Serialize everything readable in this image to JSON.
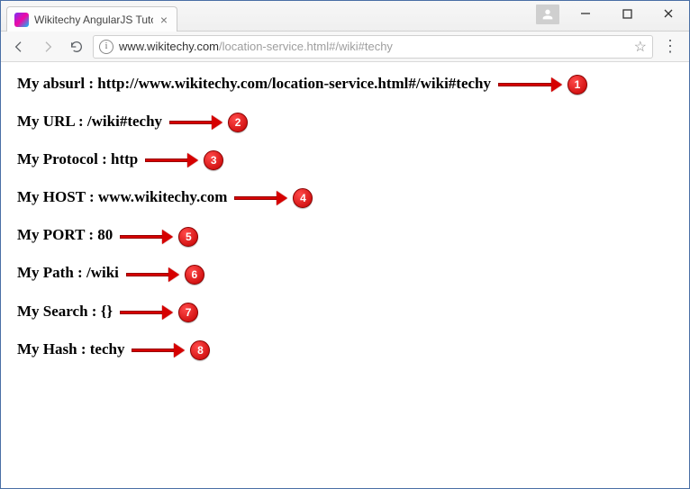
{
  "window": {
    "tab_title": "Wikitechy AngularJS Tuto",
    "url_host": "www.wikitechy.com",
    "url_path": "/location-service.html#/wiki#techy"
  },
  "rows": [
    {
      "label": "My absurl : ",
      "value": "http://www.wikitechy.com/location-service.html#/wiki#techy",
      "shaft": 60,
      "num": "1"
    },
    {
      "label": "My URL : ",
      "value": "/wiki#techy",
      "shaft": 48,
      "num": "2"
    },
    {
      "label": "My Protocol : ",
      "value": "http",
      "shaft": 48,
      "num": "3"
    },
    {
      "label": "My HOST : ",
      "value": "www.wikitechy.com",
      "shaft": 48,
      "num": "4"
    },
    {
      "label": "My PORT : ",
      "value": "80",
      "shaft": 48,
      "num": "5"
    },
    {
      "label": "My Path : ",
      "value": "/wiki",
      "shaft": 48,
      "num": "6"
    },
    {
      "label": "My Search : ",
      "value": "{}",
      "shaft": 48,
      "num": "7"
    },
    {
      "label": "My Hash : ",
      "value": "techy",
      "shaft": 48,
      "num": "8"
    }
  ]
}
